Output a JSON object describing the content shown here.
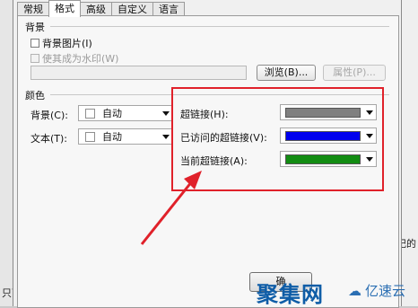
{
  "tabs": [
    "常规",
    "格式",
    "高级",
    "自定义",
    "语言"
  ],
  "background_section": {
    "title": "背景",
    "image_checkbox": "背景图片(I)",
    "watermark_checkbox": "使其成为水印(W)",
    "browse_button": "浏览(B)...",
    "properties_button": "属性(P)..."
  },
  "color_section": {
    "title": "颜色",
    "background_label": "背景(C):",
    "background_value": "自动",
    "text_label": "文本(T):",
    "text_value": "自动",
    "hyperlink_label": "超链接(H):",
    "hyperlink_color": "#808080",
    "visited_label": "已访问的超链接(V):",
    "visited_color": "#0000ee",
    "active_label": "当前超链接(A):",
    "active_color": "#128c12"
  },
  "footer": {
    "ok_partial": "确"
  },
  "background_doc": {
    "right_text": "纪的",
    "bottom_text": "只可支"
  },
  "watermark": {
    "brand1": "聚集网",
    "brand2": "亿速云"
  },
  "annotation": {
    "box_color": "#e0212a"
  }
}
